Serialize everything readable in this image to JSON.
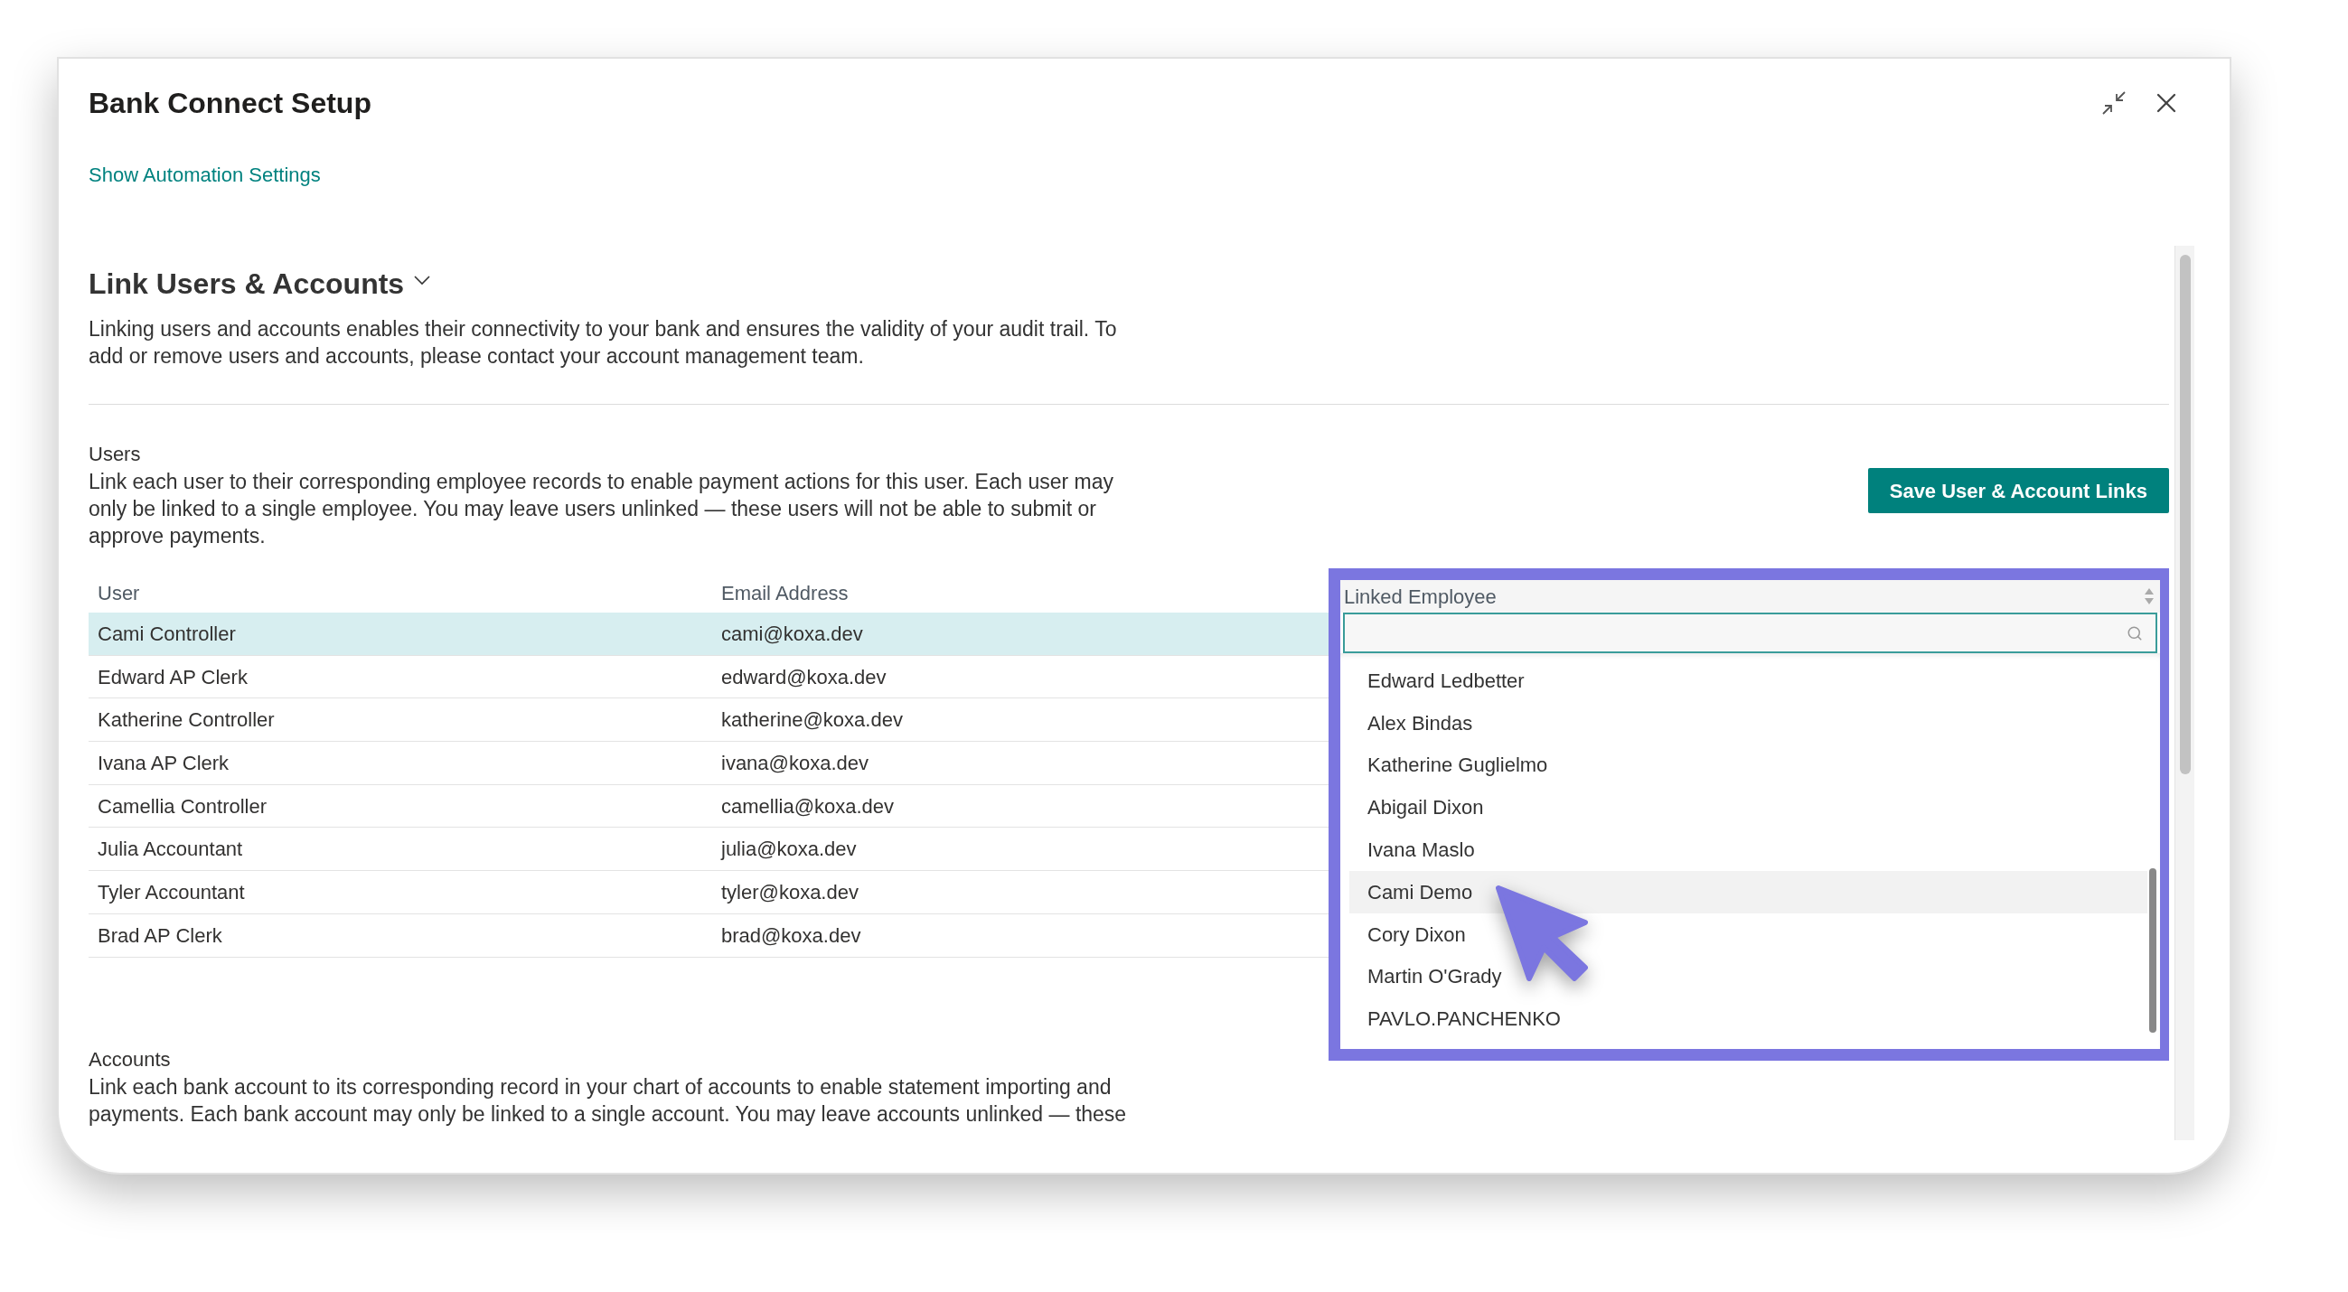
{
  "window": {
    "title": "Bank Connect Setup"
  },
  "automation_link": "Show Automation Settings",
  "section": {
    "title": "Link Users & Accounts",
    "expanded": true,
    "description": "Linking users and accounts enables their connectivity to your bank and ensures the validity of your audit trail. To add or remove users and accounts, please contact your account management team."
  },
  "users": {
    "label": "Users",
    "description": "Link each user to their corresponding employee records to enable payment actions for this user. Each user may only be linked to a single employee. You may leave users unlinked — these users will not be able to submit or approve payments.",
    "save_button": "Save User & Account Links"
  },
  "table": {
    "columns": [
      "User",
      "Email Address",
      "Linked Employee"
    ],
    "rows": [
      {
        "user": "Cami Controller",
        "email": "cami@koxa.dev",
        "selected": true
      },
      {
        "user": "Edward AP Clerk",
        "email": "edward@koxa.dev",
        "selected": false
      },
      {
        "user": "Katherine Controller",
        "email": "katherine@koxa.dev",
        "selected": false
      },
      {
        "user": "Ivana AP Clerk",
        "email": "ivana@koxa.dev",
        "selected": false
      },
      {
        "user": "Camellia Controller",
        "email": "camellia@koxa.dev",
        "selected": false
      },
      {
        "user": "Julia Accountant",
        "email": "julia@koxa.dev",
        "selected": false
      },
      {
        "user": "Tyler Accountant",
        "email": "tyler@koxa.dev",
        "selected": false
      },
      {
        "user": "Brad AP Clerk",
        "email": "brad@koxa.dev",
        "selected": false
      }
    ]
  },
  "employee_dropdown": {
    "items": [
      {
        "name": "Edward Ledbetter",
        "selected": false
      },
      {
        "name": "Alex Bindas",
        "selected": false
      },
      {
        "name": "Katherine Guglielmo",
        "selected": false
      },
      {
        "name": "Abigail Dixon",
        "selected": false
      },
      {
        "name": "Ivana Maslo",
        "selected": false
      },
      {
        "name": "Cami Demo",
        "selected": true
      },
      {
        "name": "Cory Dixon",
        "selected": false
      },
      {
        "name": "Martin O'Grady",
        "selected": false
      },
      {
        "name": "PAVLO.PANCHENKO",
        "selected": false
      }
    ]
  },
  "accounts": {
    "label": "Accounts",
    "description": "Link each bank account to its corresponding record in your chart of accounts to enable statement importing and payments. Each bank account may only be linked to a single account. You may leave accounts unlinked — these"
  }
}
